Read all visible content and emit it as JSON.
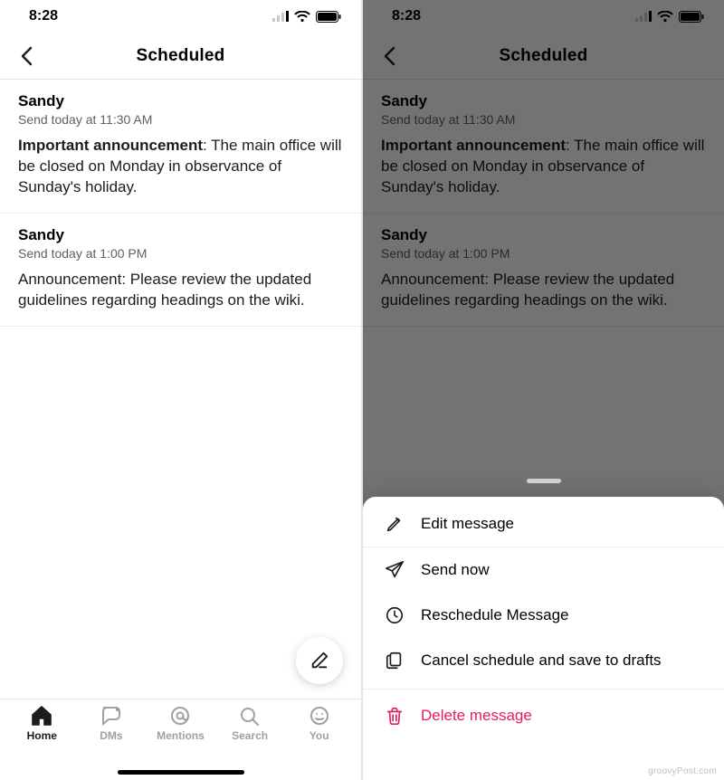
{
  "status": {
    "time": "8:28"
  },
  "header": {
    "title": "Scheduled"
  },
  "messages": [
    {
      "author": "Sandy",
      "scheduled": "Send today at 11:30 AM",
      "lead": "Important announcement",
      "body_rest": ": The main office will be closed on Monday in observance of Sunday's holiday."
    },
    {
      "author": "Sandy",
      "scheduled": "Send today at 1:00 PM",
      "lead": "",
      "body_rest": "Announcement: Please review the updated guidelines regarding headings on the wiki."
    }
  ],
  "tabs": {
    "home": "Home",
    "dms": "DMs",
    "mentions": "Mentions",
    "search": "Search",
    "you": "You"
  },
  "sheet": {
    "edit": "Edit message",
    "send_now": "Send now",
    "reschedule": "Reschedule Message",
    "cancel_save": "Cancel schedule and save to drafts",
    "delete": "Delete message"
  },
  "watermark": "groovyPost.com"
}
